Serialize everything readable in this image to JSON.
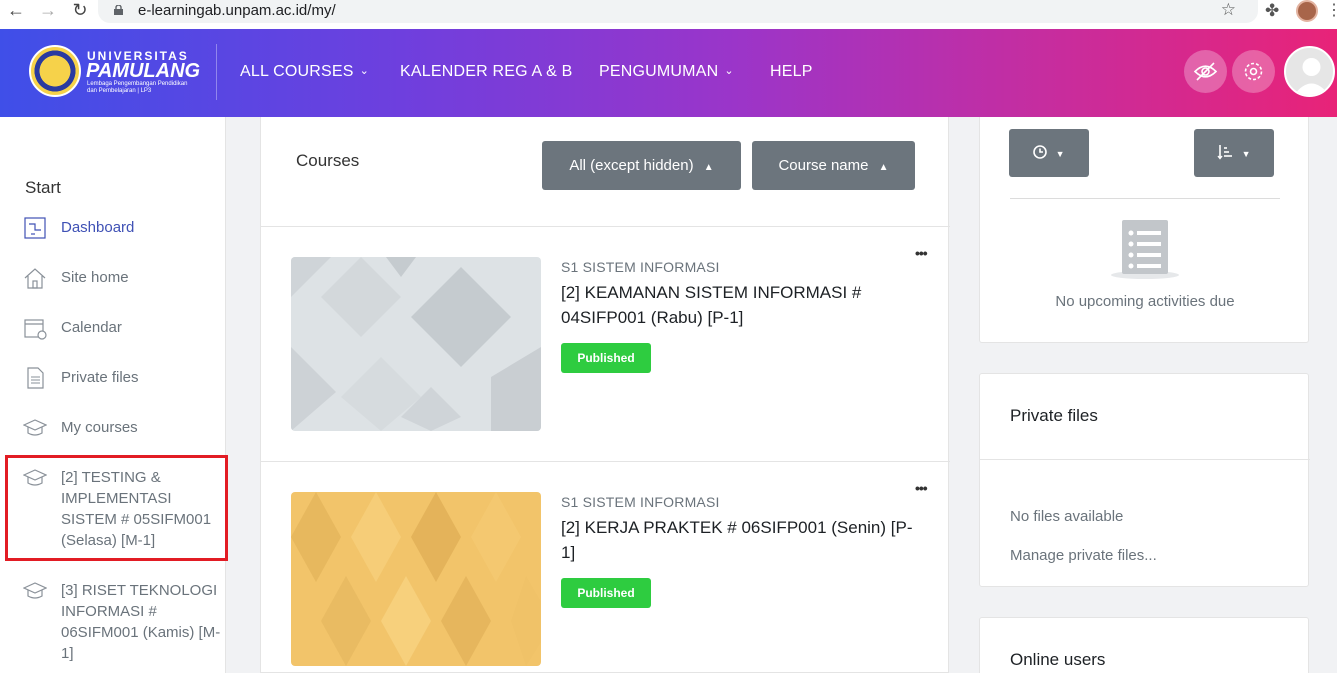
{
  "browser": {
    "url": "e-learningab.unpam.ac.id/my/"
  },
  "logo": {
    "title_line1": "UNIVERSITAS",
    "title_line2": "PAMULANG",
    "subtitle_line1": "Lembaga Pengembangan Pendidikan",
    "subtitle_line2": "dan Pembelajaran | LP3"
  },
  "navbar": {
    "items": [
      {
        "label": "ALL COURSES",
        "has_caret": true
      },
      {
        "label": "KALENDER REG A & B",
        "has_caret": false
      },
      {
        "label": "PENGUMUMAN",
        "has_caret": true
      },
      {
        "label": "HELP",
        "has_caret": false
      }
    ],
    "caret": "⌄"
  },
  "sidebar": {
    "heading": "Start",
    "items": [
      {
        "label": "Dashboard",
        "icon": "dashboard-icon",
        "active": true
      },
      {
        "label": "Site home",
        "icon": "home-icon",
        "active": false
      },
      {
        "label": "Calendar",
        "icon": "calendar-icon",
        "active": false
      },
      {
        "label": "Private files",
        "icon": "file-icon",
        "active": false
      },
      {
        "label": "My courses",
        "icon": "graduation-cap-icon",
        "active": false
      },
      {
        "label": "[2] TESTING & IMPLEMENTASI SISTEM # 05SIFM001 (Selasa) [M-1]",
        "icon": "graduation-cap-icon",
        "active": false
      },
      {
        "label": "[3] RISET TEKNOLOGI INFORMASI # 06SIFM001 (Kamis) [M-1]",
        "icon": "graduation-cap-icon",
        "active": false
      }
    ]
  },
  "courses": {
    "title": "Courses",
    "filter_label": "All (except hidden)",
    "sort_label": "Course name",
    "items": [
      {
        "category": "S1 SISTEM INFORMASI",
        "name": "[2] KEAMANAN SISTEM INFORMASI # 04SIFP001 (Rabu) [P-1]",
        "badge": "Published",
        "image_color": "#dfe3e6"
      },
      {
        "category": "S1 SISTEM INFORMASI",
        "name": "[2] KERJA PRAKTEK # 06SIFP001 (Senin) [P-1]",
        "badge": "Published",
        "image_color": "#f2c46a"
      }
    ],
    "menu_glyph": "•••"
  },
  "timeline": {
    "empty_text": "No upcoming activities due"
  },
  "private_files": {
    "title": "Private files",
    "empty_text": "No files available",
    "manage_link": "Manage private files..."
  },
  "online_users": {
    "title": "Online users"
  },
  "colors": {
    "accent": "#3f51b5",
    "published": "#2ecc40",
    "button_gray": "#6c757d",
    "highlight": "#e21c24"
  }
}
